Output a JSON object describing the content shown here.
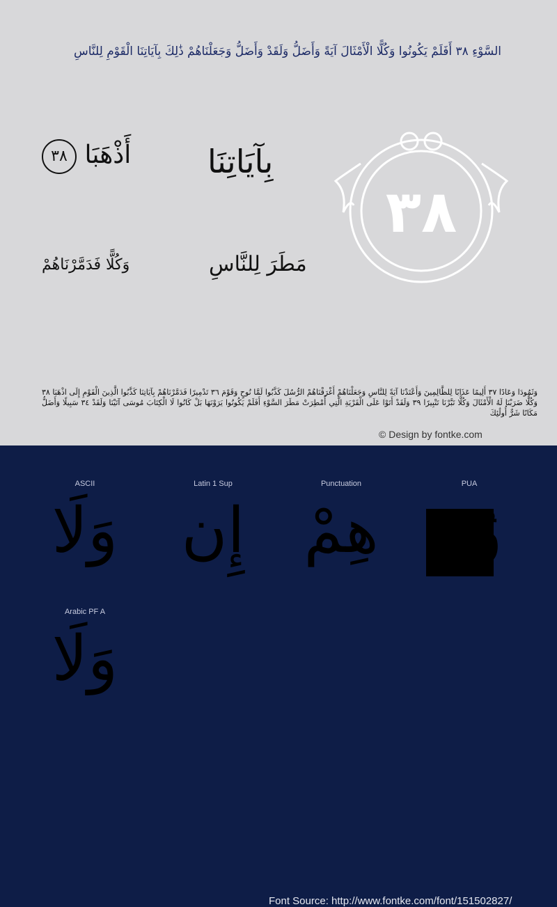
{
  "preview": {
    "line1": "السَّوْءِ ٣٨ أَفَلَمْ يَكُونُوا وَكُلًّا الْأَمْثَالَ آيَةً وَأَضَلُّ وَلَقَدْ وَأَضَلُّ وَجَعَلْنَاهُمْ ذَٰلِكَ بِآيَاتِنَا الْقَوْمِ لِلنَّاسِ",
    "sample_dhahaba": "أَذْهَبَا",
    "sample_badge": "٣٨",
    "sample_ayatina": "بِآيَاتِنَا",
    "sample_wakullan": "وَكُلًّا فَدَمَّرْنَاهُمْ",
    "sample_matar": "مَطَرَ لِلنَّاسِ",
    "medallion_number": "٣٨",
    "paragraph": "وَثَمُودَا وَعَادًا ٣٧ أَلِيمًا عَذَابًا لِلظَّالِمِينَ وَأَعْتَدْنَا آيَةً لِلنَّاسِ وَجَعَلْنَاهُمْ أَغْرَقْنَاهُمْ الرُّسُلَ كَذَّبُوا لَمَّا نُوحٍ وَقَوْمَ ٣٦ تَدْمِيرًا فَدَمَّرْنَاهُمْ بِآيَاتِنَا كَذَّبُوا الَّذِينَ الْقَوْمِ إِلَى اذْهَبَا ٣٨ وَكُلًّا ضَرَبْنَا لَهُ الْأَمْثَالَ وَكُلًّا تَبَّرْنَا تَتْبِيرًا ٣٩ وَلَقَدْ أَتَوْا عَلَى الْقَرْيَةِ الَّتِي أُمْطِرَتْ مَطَرَ السَّوْءِ أَفَلَمْ يَكُونُوا يَرَوْنَهَا بَلْ كَانُوا لَا الْكِتَابَ مُوسَى آتَيْنَا وَلَقَدْ ٣٤ سَبِيلًا وَأَضَلُّ مَكَانًا شَرٌّ أُولَٰئِكَ"
  },
  "credit": "© Design by fontke.com",
  "source": "Font Source: http://www.fontke.com/font/151502827/",
  "glyph_sets": [
    {
      "label": "ASCII",
      "glyph": "وَلَا"
    },
    {
      "label": "Latin 1 Sup",
      "glyph": "إِن"
    },
    {
      "label": "Punctuation",
      "glyph": "هِمْ"
    },
    {
      "label": "PUA",
      "glyph": "وُ"
    },
    {
      "label": "Arabic PF A",
      "glyph": "وَلَا"
    }
  ],
  "colors": {
    "preview_bg": "#d8d8da",
    "panel_bg": "#0e1d47",
    "title_text": "#1c2a66",
    "medallion": "#ffffff"
  }
}
